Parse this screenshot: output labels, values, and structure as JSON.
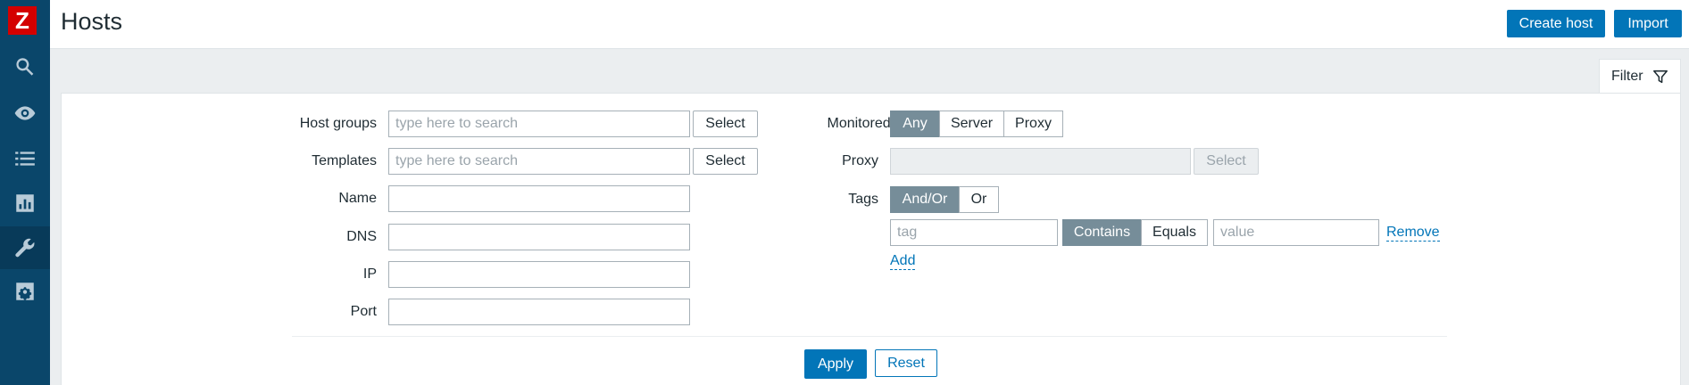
{
  "app": {
    "logo_letter": "Z",
    "brand_color": "#d40000",
    "accent_color": "#0275b8",
    "sidebar_color": "#0a466a"
  },
  "sidebar": {
    "items": [
      {
        "icon": "search-icon",
        "active": false
      },
      {
        "icon": "eye-icon",
        "active": false
      },
      {
        "icon": "list-icon",
        "active": false
      },
      {
        "icon": "bar-chart-icon",
        "active": false
      },
      {
        "icon": "wrench-icon",
        "active": true
      },
      {
        "icon": "gear-icon",
        "active": false
      }
    ]
  },
  "header": {
    "title": "Hosts",
    "create_host_label": "Create host",
    "import_label": "Import"
  },
  "filter_tab": {
    "label": "Filter",
    "icon": "funnel-icon"
  },
  "filter": {
    "host_groups": {
      "label": "Host groups",
      "placeholder": "type here to search",
      "select_label": "Select"
    },
    "templates": {
      "label": "Templates",
      "placeholder": "type here to search",
      "select_label": "Select"
    },
    "name": {
      "label": "Name",
      "value": ""
    },
    "dns": {
      "label": "DNS",
      "value": ""
    },
    "ip": {
      "label": "IP",
      "value": ""
    },
    "port": {
      "label": "Port",
      "value": ""
    },
    "monitored_by": {
      "label": "Monitored by",
      "options": [
        "Any",
        "Server",
        "Proxy"
      ],
      "selected": "Any"
    },
    "proxy": {
      "label": "Proxy",
      "value": "",
      "select_label": "Select",
      "disabled": true
    },
    "tags": {
      "label": "Tags",
      "operator_options": [
        "And/Or",
        "Or"
      ],
      "operator_selected": "And/Or",
      "rows": [
        {
          "tag_placeholder": "tag",
          "match_options": [
            "Contains",
            "Equals"
          ],
          "match_selected": "Contains",
          "value_placeholder": "value",
          "remove_label": "Remove"
        }
      ],
      "add_label": "Add"
    },
    "apply_label": "Apply",
    "reset_label": "Reset"
  }
}
